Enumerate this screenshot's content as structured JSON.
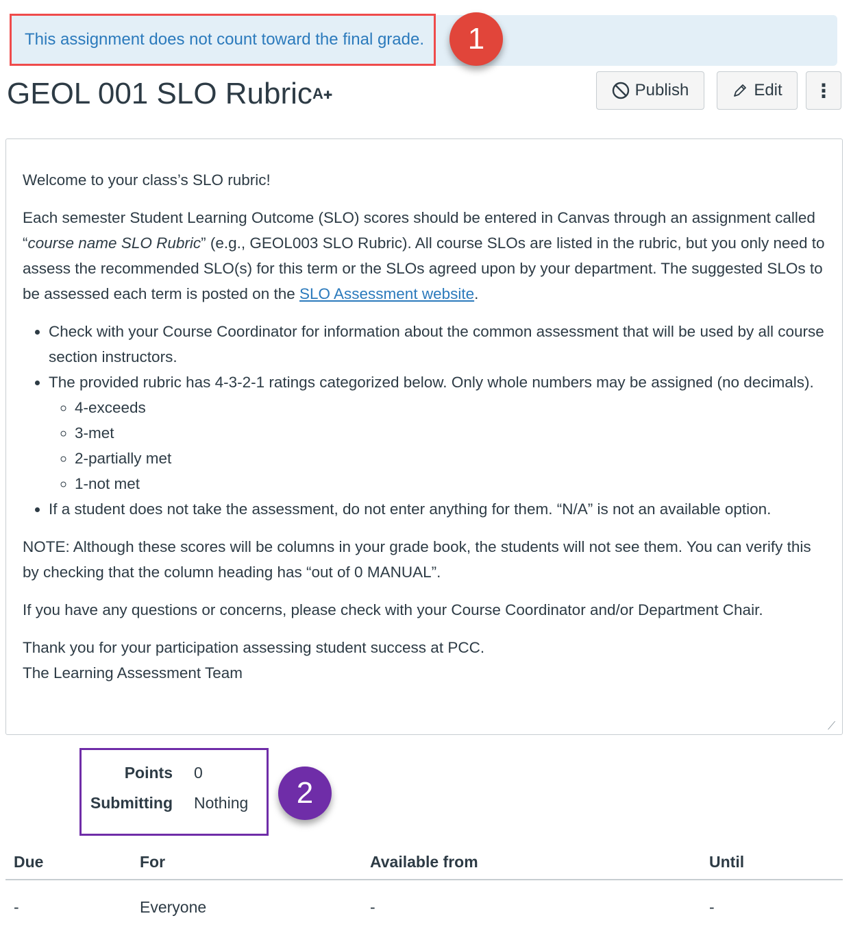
{
  "banner": {
    "text": "This assignment does not count toward the final grade."
  },
  "callouts": {
    "one": "1",
    "two": "2"
  },
  "header": {
    "title": "GEOL 001 SLO Rubric",
    "publish_label": "Publish",
    "edit_label": "Edit",
    "more_label": "⋮"
  },
  "description": {
    "welcome": "Welcome to your class’s SLO rubric!",
    "para1_a": "Each semester Student Learning Outcome (SLO) scores should be entered in Canvas through an assignment called “",
    "para1_em": "course name SLO Rubric",
    "para1_b": "” (e.g., GEOL003 SLO Rubric). All course SLOs are listed in the rubric, but you only need to assess the recommended SLO(s) for this term or the SLOs agreed upon by your department. The suggested SLOs to be assessed each term is posted on the ",
    "para1_link": "SLO Assessment website",
    "para1_c": ".",
    "bullet1": "Check with your Course Coordinator for information about the common assessment that will be used by all course section instructors.",
    "bullet2": "The provided rubric has 4-3-2-1 ratings categorized below. Only whole numbers may be assigned (no decimals).",
    "ratings": [
      "4-exceeds",
      "3-met",
      "2-partially met",
      "1-not met"
    ],
    "bullet3": "If a student does not take the assessment, do not enter anything for them. “N/A” is not an available option.",
    "note": "NOTE: Although these scores will be columns in your grade book, the students will not see them. You can verify this by checking that the column heading has “out of 0 MANUAL”.",
    "questions": "If you have any questions or concerns, please check with your Course Coordinator and/or Department Chair.",
    "thanks": "Thank you for your participation assessing student success at PCC.",
    "signature": "The Learning Assessment Team"
  },
  "details": {
    "points_label": "Points",
    "points_value": "0",
    "submitting_label": "Submitting",
    "submitting_value": "Nothing"
  },
  "table": {
    "headers": [
      "Due",
      "For",
      "Available from",
      "Until"
    ],
    "row": [
      "-",
      "Everyone",
      "-",
      "-"
    ]
  },
  "colors": {
    "banner_bg": "#e3eff7",
    "banner_text": "#2b7abc",
    "callout_red": "#ef4b4b",
    "callout_purple": "#6f2da8",
    "link": "#2b7abc"
  },
  "icons": {
    "direction": "text-direction-icon",
    "publish": "ban-icon",
    "edit": "pencil-icon",
    "more": "kebab-menu-icon",
    "resize": "resize-grip-icon"
  }
}
